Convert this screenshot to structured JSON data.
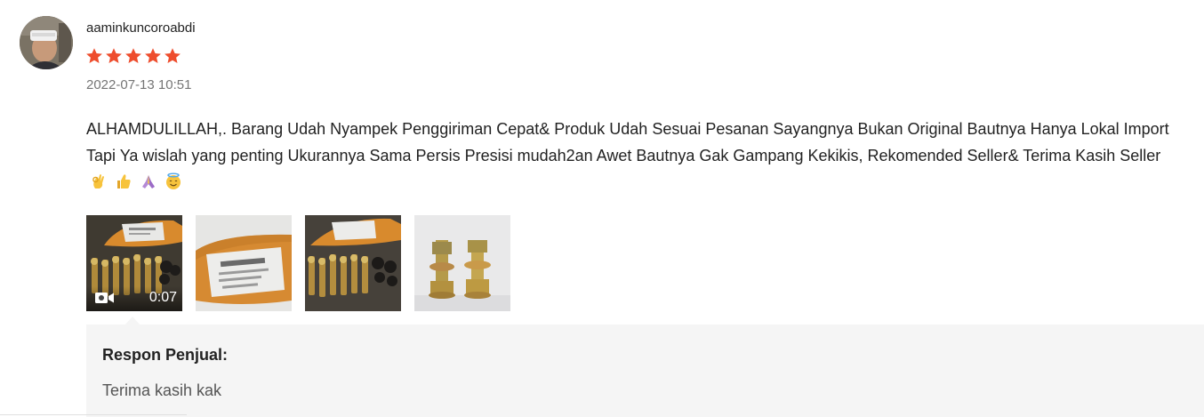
{
  "review": {
    "username": "aaminkuncoroabdi",
    "rating": 5,
    "rating_max": 5,
    "timestamp": "2022-07-13 10:51",
    "comment": "ALHAMDULILLAH,. Barang Udah Nyampek Penggiriman Cepat& Produk Udah Sesuai Pesanan Sayangnya Bukan Original Bautnya Hanya Lokal Import Tapi Ya wislah yang penting Ukurannya Sama Persis Presisi mudah2an Awet Bautnya Gak Gampang Kekikis, Rekomended Seller& Terima Kasih Seller",
    "emojis": [
      "ok-hand-icon",
      "thumbs-up-icon",
      "folded-hands-icon",
      "smiling-face-with-halo-icon"
    ],
    "star_color": "#ee4d2d"
  },
  "media": [
    {
      "type": "video",
      "duration": "0:07",
      "icon": "video-camera-icon"
    },
    {
      "type": "image"
    },
    {
      "type": "image"
    },
    {
      "type": "image"
    }
  ],
  "seller_reply": {
    "title": "Respon Penjual:",
    "text": "Terima kasih kak"
  }
}
